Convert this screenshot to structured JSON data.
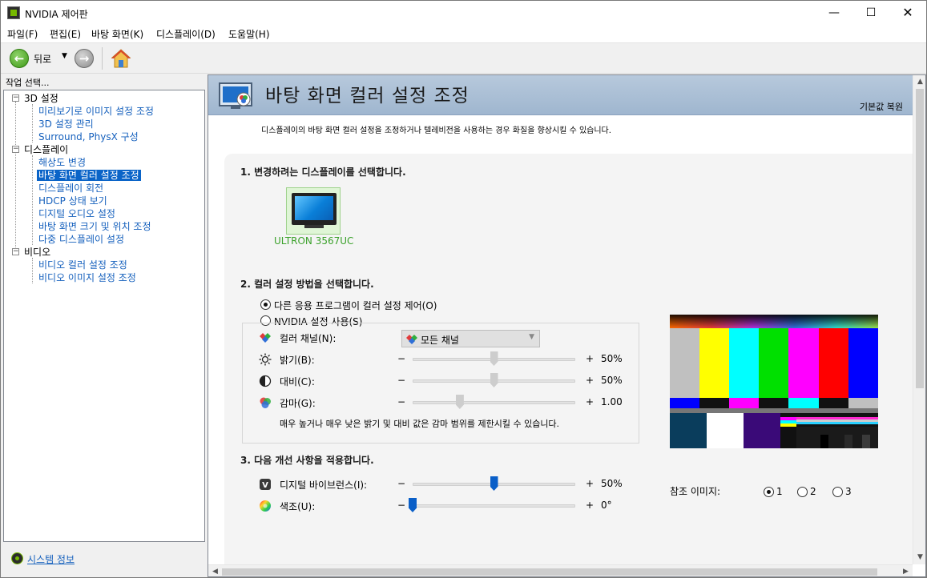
{
  "window": {
    "title": "NVIDIA 제어판",
    "minimize": "—",
    "maximize": "☐",
    "close": "✕"
  },
  "menu": [
    "파일(F)",
    "편집(E)",
    "바탕 화면(K)",
    "디스플레이(D)",
    "도움말(H)"
  ],
  "toolbar": {
    "back_label": "뒤로",
    "back_dropdown": "▼",
    "back_arrow": "←",
    "forward_arrow": "→"
  },
  "left_pane": {
    "header": "작업 선택...",
    "tree": [
      {
        "type": "category",
        "label": "3D 설정",
        "toggle": "−"
      },
      {
        "type": "link",
        "label": "미리보기로 이미지 설정 조정"
      },
      {
        "type": "link",
        "label": "3D 설정 관리"
      },
      {
        "type": "link",
        "label": "Surround, PhysX 구성"
      },
      {
        "type": "category",
        "label": "디스플레이",
        "toggle": "−"
      },
      {
        "type": "link",
        "label": "해상도 변경"
      },
      {
        "type": "link",
        "label": "바탕 화면 컬러 설정 조정",
        "selected": true
      },
      {
        "type": "link",
        "label": "디스플레이 회전"
      },
      {
        "type": "link",
        "label": "HDCP 상태 보기"
      },
      {
        "type": "link",
        "label": "디지털 오디오 설정"
      },
      {
        "type": "link",
        "label": "바탕 화면 크기 및 위치 조정"
      },
      {
        "type": "link",
        "label": "다중 디스플레이 설정"
      },
      {
        "type": "category",
        "label": "비디오",
        "toggle": "−"
      },
      {
        "type": "link",
        "label": "비디오 컬러 설정 조정"
      },
      {
        "type": "link",
        "label": "비디오 이미지 설정 조정"
      }
    ],
    "system_info": "시스템 정보"
  },
  "page": {
    "title": "바탕 화면 컬러 설정 조정",
    "restore_defaults": "기본값 복원",
    "description": "디스플레이의 바탕 화면 컬러 설정을 조정하거나 텔레비전을 사용하는 경우 화질을 향상시킬 수 있습니다.",
    "step1": "1. 변경하려는 디스플레이를 선택합니다.",
    "display_name": "ULTRON 3567UC",
    "step2": "2. 컬러 설정 방법을 선택합니다.",
    "option_other_app": "다른 응용 프로그램이 컬러 설정 제어(O)",
    "option_nvidia": "NVIDIA 설정 사용(S)",
    "color_channel_label": "컬러 채널(N):",
    "color_channel_value": "모든 채널",
    "brightness": {
      "label": "밝기(B):",
      "minus": "−",
      "plus": "+",
      "value": "50%",
      "level": 0.5
    },
    "contrast": {
      "label": "대비(C):",
      "minus": "−",
      "plus": "+",
      "value": "50%",
      "level": 0.5
    },
    "gamma": {
      "label": "감마(G):",
      "minus": "−",
      "plus": "+",
      "value": "1.00",
      "level": 0.29
    },
    "warning": "매우 높거나 매우 낮은 밝기 및 대비 값은 감마 범위를 제한시킬 수 있습니다.",
    "step3": "3. 다음 개선 사항을 적용합니다.",
    "vibrance": {
      "label": "디지털 바이브런스(I):",
      "minus": "−",
      "plus": "+",
      "value": "50%",
      "level": 0.5
    },
    "hue": {
      "label": "색조(U):",
      "minus": "−",
      "plus": "+",
      "value": "0°",
      "level": 0.0
    },
    "reference_label": "참조 이미지:",
    "reference_options": [
      "1",
      "2",
      "3"
    ],
    "reference_selected": "1"
  },
  "colors": {
    "accent": "#0a64c8",
    "link": "#1560bd",
    "nvidia_green": "#76b900",
    "display_label": "#3aa12a"
  },
  "icons": {
    "app": "nvidia-icon",
    "back": "back-arrow-icon",
    "forward": "forward-arrow-icon",
    "home": "home-icon",
    "banner": "desktop-color-icon",
    "brightness": "sun-icon",
    "contrast": "contrast-icon",
    "gamma": "rgb-circles-icon",
    "vibrance": "vibrance-icon",
    "hue": "color-wheel-icon",
    "channel": "rgb-diamond-icon"
  }
}
